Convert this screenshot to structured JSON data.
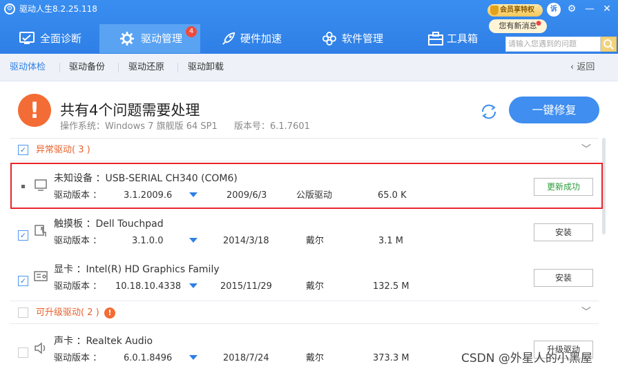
{
  "app": {
    "title": "驱动人生8.2.25.118",
    "vip_label": "会员享特权",
    "message_label": "您有新消息",
    "sue_label": "诉"
  },
  "nav": {
    "tabs": [
      {
        "label": "全面诊断"
      },
      {
        "label": "驱动管理",
        "badge": "4"
      },
      {
        "label": "硬件加速"
      },
      {
        "label": "软件管理"
      },
      {
        "label": "工具箱"
      }
    ]
  },
  "search": {
    "placeholder": "请输入您遇到的问题"
  },
  "subnav": {
    "tabs": [
      "驱动体检",
      "驱动备份",
      "驱动还原",
      "驱动卸载"
    ],
    "back_label": "返回"
  },
  "summary": {
    "headline": "共有4个问题需要处理",
    "os": "操作系统：Windows 7 旗舰版  64 SP1",
    "version": "版本号：6.1.7601",
    "fix_button": "一键修复"
  },
  "sections": [
    {
      "label": "异常驱动( 3 )"
    },
    {
      "label": "可升级驱动( 2 )"
    }
  ],
  "drivers": [
    {
      "name": "未知设备  ：USB-SERIAL CH340 (COM6)",
      "version_label": "驱动版本  ：",
      "version": "3.1.2009.6",
      "date": "2009/6/3",
      "vendor": "公版驱动",
      "size": "65.0 K",
      "action": "更新成功"
    },
    {
      "name": "触摸板  ：Dell Touchpad",
      "version_label": "驱动版本  ：",
      "version": "3.1.0.0",
      "date": "2014/3/18",
      "vendor": "戴尔",
      "size": "3.1 M",
      "action": "安装"
    },
    {
      "name": "显卡  ：Intel(R) HD Graphics Family",
      "version_label": "驱动版本  ：",
      "version": "10.18.10.4338",
      "date": "2015/11/29",
      "vendor": "戴尔",
      "size": "132.5 M",
      "action": "安装"
    },
    {
      "name": "声卡  ：Realtek Audio",
      "version_label": "驱动版本  ：",
      "version": "6.0.1.8496",
      "date": "2018/7/24",
      "vendor": "戴尔",
      "size": "373.3 M",
      "action": "升级驱动"
    }
  ],
  "watermark": "CSDN @外星人的小黑屋",
  "colors": {
    "accent": "#2f7fe6",
    "warning": "#f36c35",
    "success": "#2a9d3a",
    "highlight": "#e8242a"
  }
}
